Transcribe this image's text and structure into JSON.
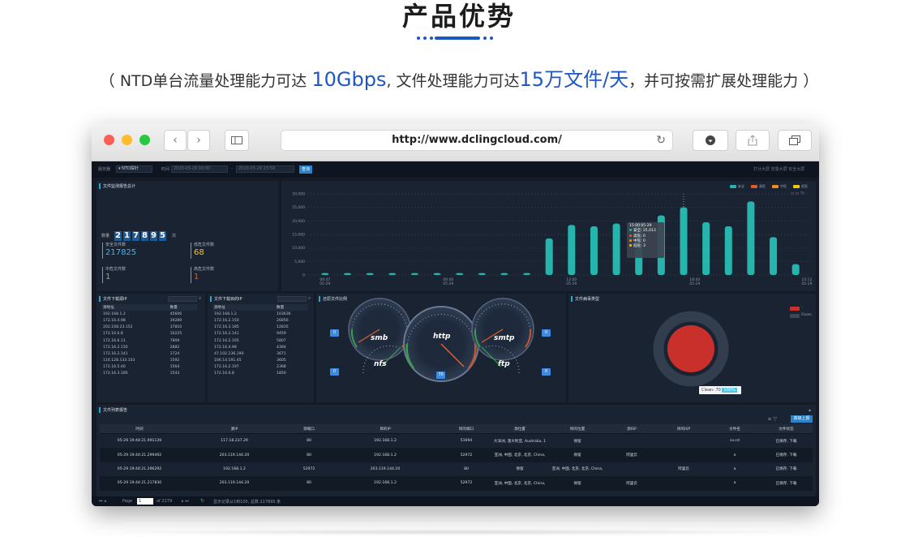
{
  "page": {
    "title": "产品优势",
    "subtitle_prefix": "（ NTD单台流量处理能力可达 ",
    "subtitle_hl1": "10Gbps",
    "subtitle_mid": ", 文件处理能力可达",
    "subtitle_hl2": "15万文件/天",
    "subtitle_suffix": "，并可按需扩展处理能力 ）",
    "accent_color": "#1c57c4"
  },
  "browser": {
    "url": "http://www.dclingcloud.com/",
    "back_icon": "chevron-left-icon",
    "forward_icon": "chevron-right-icon",
    "sidebar_icon": "sidebar-icon",
    "reload_icon": "reload-icon",
    "download_icon": "download-icon",
    "share_icon": "share-icon",
    "tabs_icon": "tabs-icon"
  },
  "app": {
    "topbar": {
      "server_label": "服务器",
      "server_value": "NTD探针",
      "time_label": "时间",
      "time_start": "2020-05-29 00:00",
      "dash": "-",
      "time_end": "2020-05-29 23:59",
      "query_button": "查询",
      "right_links": "打分大屏  告警大屏  安全大屏"
    },
    "summary": {
      "title": "文件监测报告总计",
      "count_label": "数量",
      "count_digits": [
        "2",
        "1",
        "7",
        "8",
        "9",
        "5"
      ],
      "count_unit": "次",
      "safe_label": "安全文件数",
      "safe_value": "217825",
      "low_label": "低危文件数",
      "low_value": "68",
      "mid_label": "中危文件数",
      "mid_value": "1",
      "high_label": "高危文件数",
      "high_value": "1"
    },
    "tooltip": {
      "time": "15:00 05-29",
      "safe": "安全: 25,013",
      "high": "高危: 0",
      "mid": "中危: 0",
      "low": "低危: 3"
    },
    "src_table": {
      "title": "文件下载源IP",
      "headers": [
        "源地址",
        "数量"
      ],
      "rows": [
        [
          "192.168.1.2",
          "45606"
        ],
        [
          "172.16.4.98",
          "39289"
        ],
        [
          "202.108.23.152",
          "37810"
        ],
        [
          "172.16.6.8",
          "10225"
        ],
        [
          "172.16.6.11",
          "7809"
        ],
        [
          "172.16.2.150",
          "2882"
        ],
        [
          "172.16.2.141",
          "1724"
        ],
        [
          "116.128.133.103",
          "1592"
        ],
        [
          "172.16.5.46",
          "1564"
        ],
        [
          "172.16.3.185",
          "1543"
        ]
      ]
    },
    "dst_table": {
      "title": "文件下载目的IP",
      "headers": [
        "源地址",
        "数量"
      ],
      "rows": [
        [
          "192.168.1.2",
          "103636"
        ],
        [
          "172.16.2.150",
          "26856"
        ],
        [
          "172.16.3.185",
          "12835"
        ],
        [
          "172.16.2.141",
          "9459"
        ],
        [
          "172.16.2.165",
          "5807"
        ],
        [
          "172.16.4.98",
          "4394"
        ],
        [
          "47.102.136.190",
          "3671"
        ],
        [
          "106.14.191.45",
          "3605"
        ],
        [
          "172.16.2.197",
          "2368"
        ],
        [
          "172.16.6.8",
          "1850"
        ]
      ]
    },
    "protocol": {
      "title": "还原文件比例",
      "gauges": [
        {
          "name": "smb",
          "value": "0"
        },
        {
          "name": "http",
          "value": "70"
        },
        {
          "name": "smtp",
          "value": "0"
        },
        {
          "name": "nfs",
          "value": "0"
        },
        {
          "name": "ftp",
          "value": "0"
        }
      ]
    },
    "virus": {
      "title": "文件病毒类型",
      "legend_clean": "Clean",
      "legend_dash": "-",
      "tooltip_label": "Clean: 70",
      "tooltip_pct": "100%",
      "clean_color": "#c9302c"
    },
    "list": {
      "title": "文件列表报告",
      "export_button": "高级上报",
      "headers": [
        "时间",
        "源IP",
        "源端口",
        "目的IP",
        "目的端口",
        "源位置",
        "目的位置",
        "源ISP",
        "目的ISP",
        "文件名",
        "文件状态"
      ],
      "rows": [
        [
          "05-29 19:44:21.991139",
          "117.18.237.29",
          "80",
          "192.168.1.2",
          "51694",
          "大洋洲, 澳大利亚, Australia, 1",
          "保留",
          "",
          "",
          "sv.cd",
          "已保存, 下载"
        ],
        [
          "05-29 19:44:21.299492",
          "203.119.144.20",
          "80",
          "192.168.1.2",
          "52972",
          "亚洲, 中国, 北京, 北京, China,",
          "保留",
          "阿里云",
          "",
          "a",
          "已保存, 下载"
        ],
        [
          "05-29 19:44:21.296292",
          "192.168.1.2",
          "52972",
          "203.119.144.20",
          "80",
          "保留",
          "亚洲, 中国, 北京, 北京, China,",
          "",
          "阿里云",
          "a",
          "已保存, 下载"
        ],
        [
          "05-29 19:44:21.217830",
          "203.119.144.20",
          "80",
          "192.168.1.2",
          "52972",
          "亚洲, 中国, 北京, 北京, China,",
          "保留",
          "阿里云",
          "",
          "a",
          "已保存, 下载"
        ]
      ]
    },
    "pager": {
      "page_label": "Page",
      "page_value": "1",
      "of_label": "of 2179",
      "summary": "显示记录从1到100, 总数 217895 条"
    }
  },
  "chart_data": {
    "type": "bar",
    "title": "",
    "legend": [
      "安全",
      "高危",
      "中危",
      "低危"
    ],
    "legend_colors": [
      "#26b5ad",
      "#e05a2b",
      "#f08c1e",
      "#f0c419"
    ],
    "legend_position": "top-right",
    "ylim": [
      0,
      30000
    ],
    "yticks": [
      0,
      5000,
      10000,
      15000,
      20000,
      25000,
      30000
    ],
    "ytick_labels": [
      "0",
      "5,000",
      "10,000",
      "15,000",
      "20,000",
      "25,000",
      "30,000"
    ],
    "xtick_labels": [
      "00:47\n05-29",
      "06:00\n05-29",
      "12:00\n05-29",
      "18:00\n05-29",
      "23:12\n05-29"
    ],
    "series": [
      {
        "name": "安全",
        "values": [
          700,
          700,
          700,
          700,
          700,
          700,
          700,
          700,
          700,
          700,
          13500,
          18500,
          18000,
          19000,
          19500,
          22000,
          25013,
          19500,
          18000,
          27200,
          14000,
          4000
        ]
      }
    ]
  }
}
